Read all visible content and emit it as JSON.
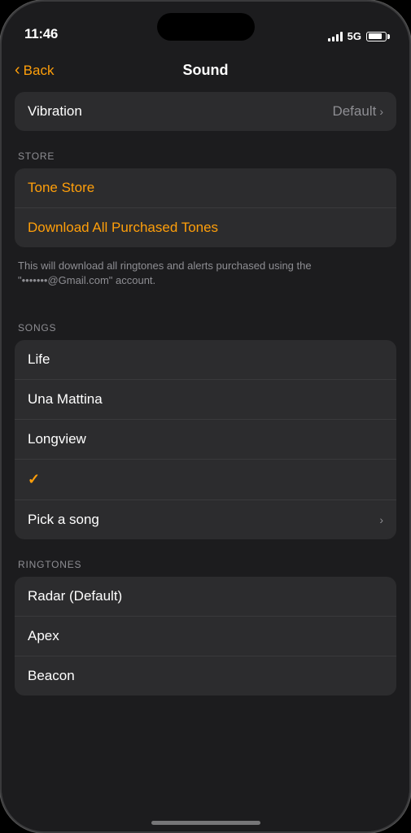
{
  "status": {
    "time": "11:46",
    "signal_label": "5G"
  },
  "nav": {
    "back_label": "Back",
    "title": "Sound"
  },
  "vibration": {
    "label": "Vibration",
    "value": "Default"
  },
  "store_section": {
    "header": "STORE",
    "tone_store": "Tone Store",
    "download_all": "Download All Purchased Tones",
    "note": "This will download all ringtones and alerts purchased using the \"•••••••@Gmail.com\" account."
  },
  "songs_section": {
    "header": "SONGS",
    "items": [
      {
        "label": "Life"
      },
      {
        "label": "Una Mattina"
      },
      {
        "label": "Longview"
      }
    ],
    "pick_song": "Pick a song"
  },
  "ringtones_section": {
    "header": "RINGTONES",
    "items": [
      {
        "label": "Radar (Default)"
      },
      {
        "label": "Apex"
      },
      {
        "label": "Beacon"
      }
    ]
  }
}
